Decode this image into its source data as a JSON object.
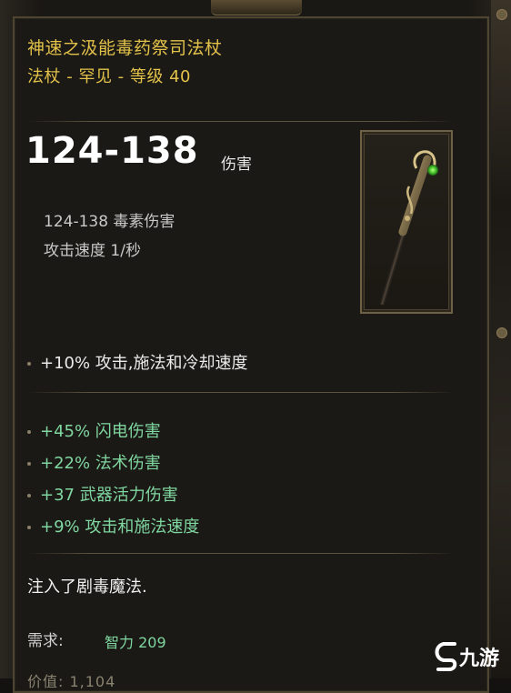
{
  "item": {
    "name": "神速之汲能毒药祭司法杖",
    "type_line": "法杖 - 罕见 - 等级 40",
    "damage_range": "124-138",
    "damage_unit": "伤害",
    "damage_detail": "124-138 毒素伤害",
    "attack_speed": "攻击速度 1/秒",
    "implicit_affixes": [
      "+10% 攻击,施法和冷却速度"
    ],
    "affixes": [
      "+45% 闪电伤害",
      "+22% 法术伤害",
      "+37 武器活力伤害",
      "+9% 攻击和施法速度"
    ],
    "lore": "注入了剧毒魔法.",
    "requirement_label": "需求:",
    "requirement_value": "智力 209",
    "cutoff_line": "价值: 1,104"
  },
  "watermark": {
    "text": "九游"
  },
  "colors": {
    "title": "#e2c24a",
    "affix_green": "#7fd6a0",
    "frame": "#6e6246",
    "background": "#1b1915"
  },
  "icons": {
    "weapon": "staff-icon",
    "watermark": "jiuyou-logo-icon"
  }
}
